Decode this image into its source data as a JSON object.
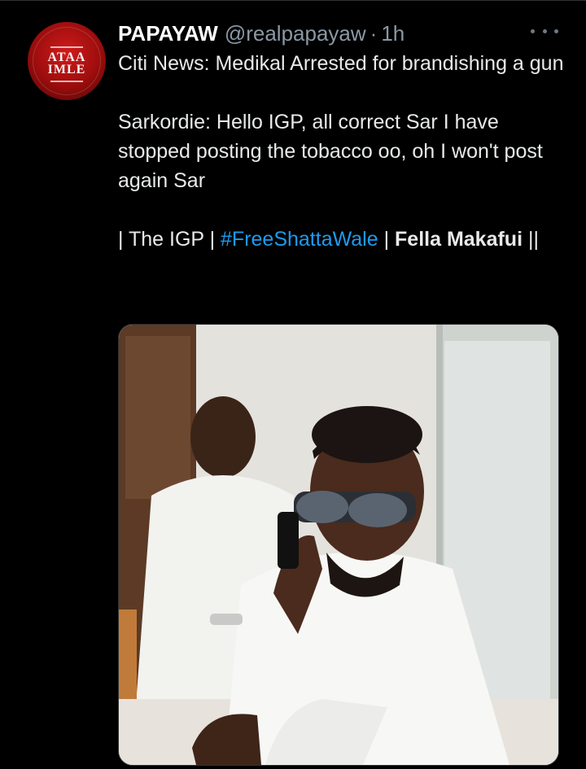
{
  "tweet": {
    "display_name": "PAPAYAW",
    "handle": "@realpapayaw",
    "separator": "·",
    "time": "1h",
    "avatar_logo_text": "ATAA\nIMLE",
    "lines": {
      "p1": "Citi News: Medikal Arrested for brandishing a gun",
      "p2": "Sarkordie: Hello IGP, all correct Sar I have stopped posting the tobacco oo, oh I won't post again Sar",
      "p3_pre": "| The IGP | ",
      "p3_hashtag": "#FreeShattaWale",
      "p3_mid": " | ",
      "p3_bold": "Fella Makafui",
      "p3_post": " ||"
    },
    "colors": {
      "background": "#000000",
      "text": "#e7e9ea",
      "muted": "#8b98a5",
      "hashtag": "#1d9bf0"
    },
    "icons": {
      "more": "more-horizontal-icon"
    }
  }
}
